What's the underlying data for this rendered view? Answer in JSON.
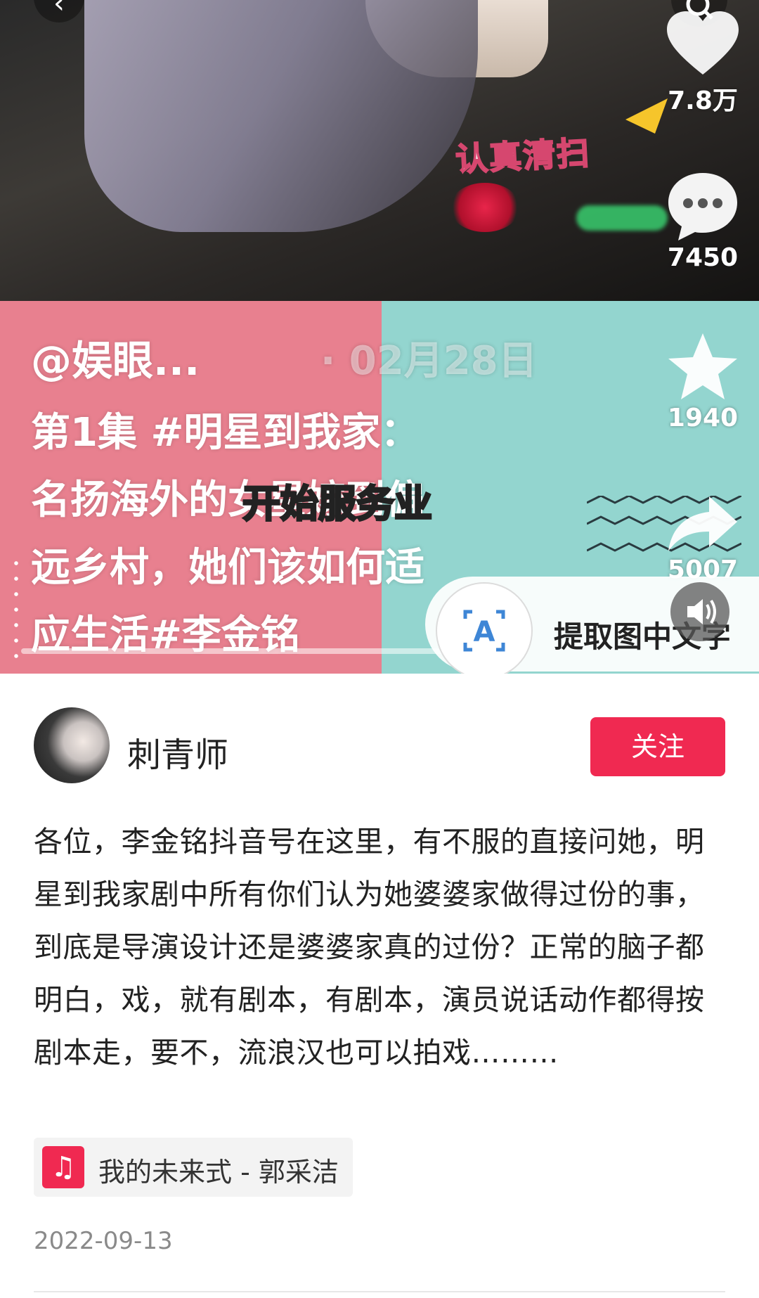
{
  "video": {
    "sticker_text": "认真清扫",
    "account_tag": "@娱眼...",
    "upload_date_ghost": "· 02月28日",
    "caption_lines": [
      "第1集 #明星到我家：",
      "名扬海外的女星嫁到偏",
      "远乡村，她们该如何适",
      "应生活#李金铭"
    ],
    "subtitle_overlay": "开始服务业"
  },
  "rail": {
    "likes": "7.8万",
    "comments": "7450",
    "favorites": "1940",
    "shares": "5007"
  },
  "ocr": {
    "label": "提取图中文字"
  },
  "author": {
    "name": "刺青师",
    "follow_label": "关注"
  },
  "post": {
    "body": "各位，李金铭抖音号在这里，有不服的直接问她，明星到我家剧中所有你们认为她婆婆家做得过份的事，到底是导演设计还是婆婆家真的过份？正常的脑子都明白，戏，就有剧本，有剧本，演员说话动作都得按剧本走，要不，流浪汉也可以拍戏………",
    "music": "我的未来式 - 郭采洁",
    "date": "2022-09-13"
  },
  "colors": {
    "accent": "#f02951",
    "left_panel": "#e8808f",
    "right_panel": "#93d5cf"
  },
  "icons": [
    "back-icon",
    "search-icon",
    "heart-icon",
    "comment-icon",
    "star-icon",
    "share-icon",
    "text-scan-icon",
    "speaker-icon",
    "music-note-icon"
  ]
}
